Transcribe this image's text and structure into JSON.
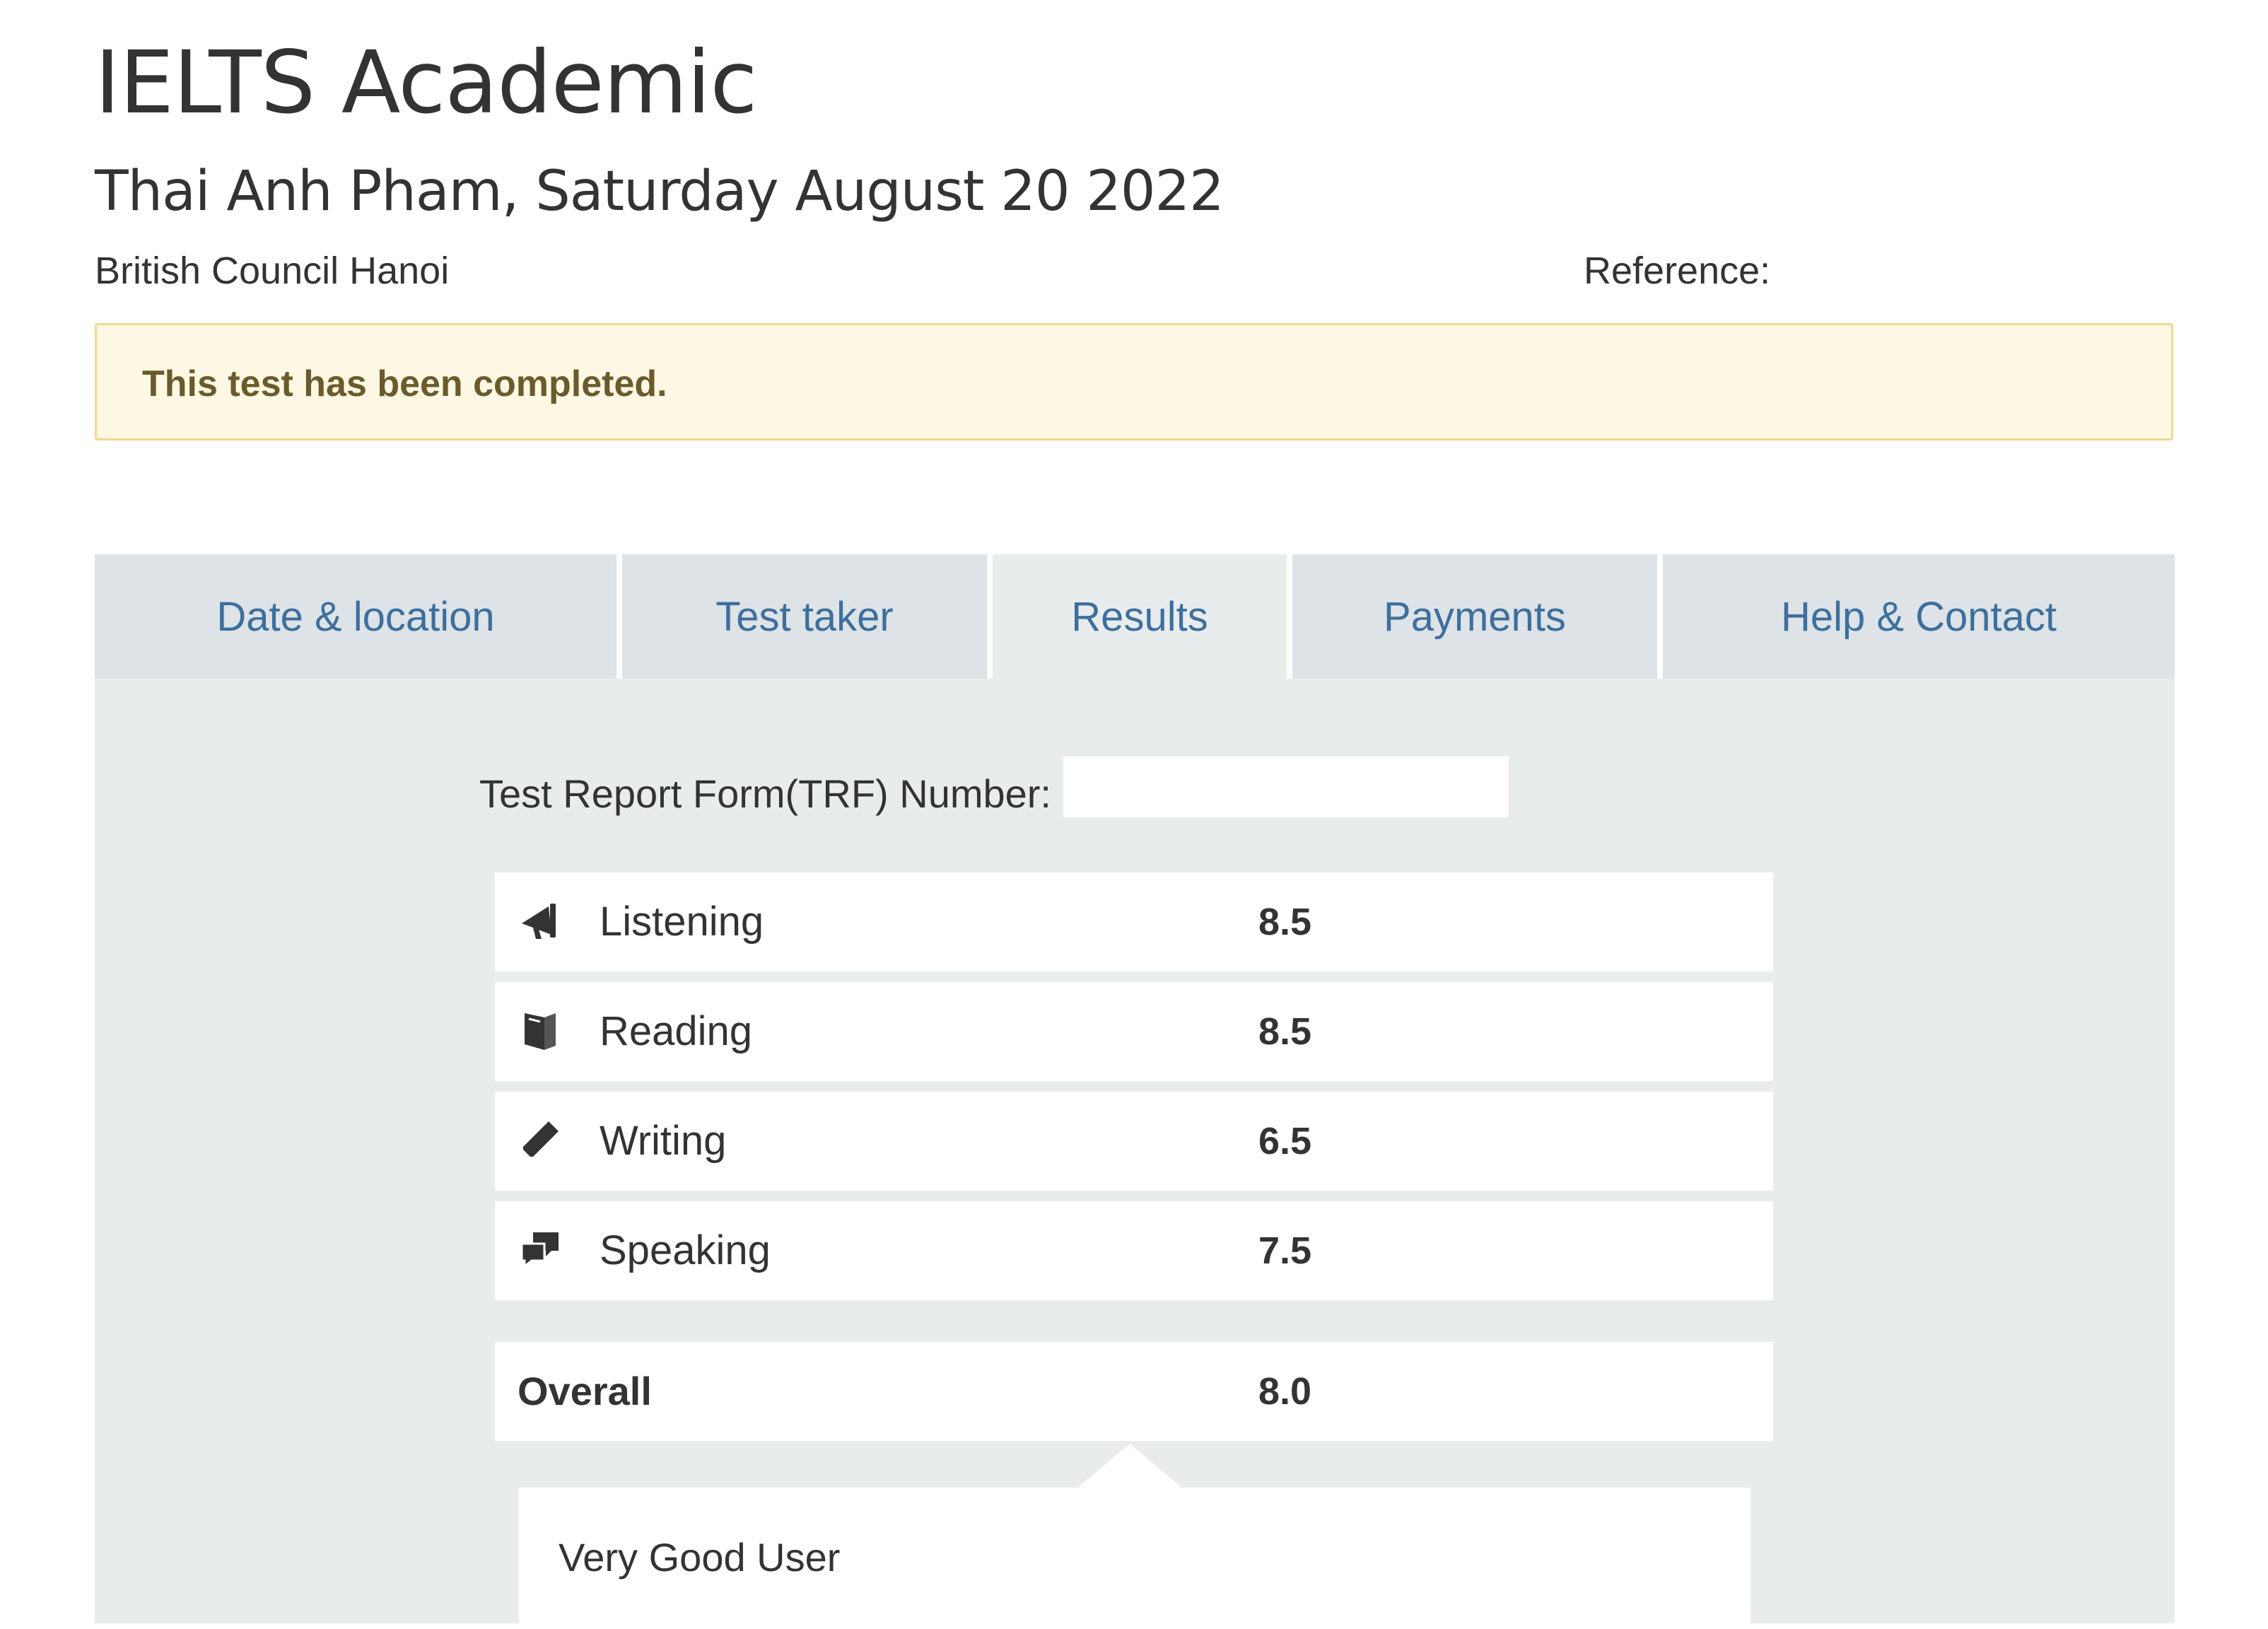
{
  "header": {
    "title": "IELTS Academic",
    "subtitle": "Thai Anh Pham, Saturday August 20 2022",
    "test_centre": "British Council Hanoi",
    "reference_label": "Reference:"
  },
  "alert": {
    "message": "This test has been completed."
  },
  "tabs": [
    {
      "label": "Date & location",
      "active": false
    },
    {
      "label": "Test taker",
      "active": false
    },
    {
      "label": "Results",
      "active": true
    },
    {
      "label": "Payments",
      "active": false
    },
    {
      "label": "Help & Contact",
      "active": false
    }
  ],
  "results": {
    "trf_label": "Test Report Form(TRF) Number:",
    "scores": [
      {
        "skill": "Listening",
        "score": "8.5",
        "icon": "megaphone-icon"
      },
      {
        "skill": "Reading",
        "score": "8.5",
        "icon": "book-icon"
      },
      {
        "skill": "Writing",
        "score": "6.5",
        "icon": "pencil-icon"
      },
      {
        "skill": "Speaking",
        "score": "7.5",
        "icon": "speech-bubbles-icon"
      }
    ],
    "overall": {
      "label": "Overall",
      "score": "8.0"
    },
    "band_description": "Very Good User"
  },
  "colors": {
    "tab_text": "#3d6f9e",
    "alert_background": "#fcf8e3",
    "alert_border": "#f0d890",
    "panel_background": "#e9eced"
  }
}
